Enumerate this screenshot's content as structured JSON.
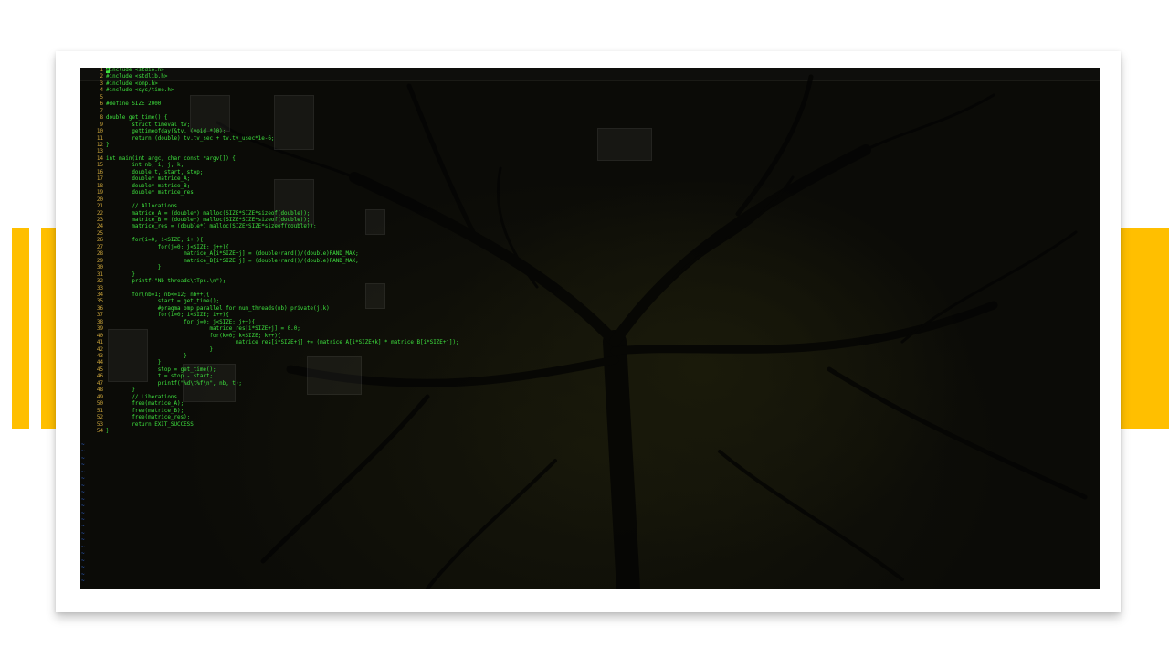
{
  "colors": {
    "accent": "#ffbf00",
    "code_green": "#3ee03e",
    "line_number": "#c8a23a",
    "tilde_blue": "#2f66d8",
    "screen_bg": "#0b0b07"
  },
  "editor": {
    "cursor_char": "#",
    "tilde_count": 21,
    "tilde_char": "~",
    "lines": [
      {
        "n": "1",
        "t": "include <stdio.h>"
      },
      {
        "n": "2",
        "t": "#include <stdlib.h>"
      },
      {
        "n": "3",
        "t": "#include <omp.h>"
      },
      {
        "n": "4",
        "t": "#include <sys/time.h>"
      },
      {
        "n": "5",
        "t": ""
      },
      {
        "n": "6",
        "t": "#define SIZE 2000"
      },
      {
        "n": "7",
        "t": ""
      },
      {
        "n": "8",
        "t": "double get_time() {"
      },
      {
        "n": "9",
        "t": "        struct timeval tv;"
      },
      {
        "n": "10",
        "t": "        gettimeofday(&tv, (void *)0);"
      },
      {
        "n": "11",
        "t": "        return (double) tv.tv_sec + tv.tv_usec*1e-6;"
      },
      {
        "n": "12",
        "t": "}"
      },
      {
        "n": "13",
        "t": ""
      },
      {
        "n": "14",
        "t": "int main(int argc, char const *argv[]) {"
      },
      {
        "n": "15",
        "t": "        int nb, i, j, k;"
      },
      {
        "n": "16",
        "t": "        double t, start, stop;"
      },
      {
        "n": "17",
        "t": "        double* matrice_A;"
      },
      {
        "n": "18",
        "t": "        double* matrice_B;"
      },
      {
        "n": "19",
        "t": "        double* matrice_res;"
      },
      {
        "n": "20",
        "t": ""
      },
      {
        "n": "21",
        "t": "        // Allocations"
      },
      {
        "n": "22",
        "t": "        matrice_A = (double*) malloc(SIZE*SIZE*sizeof(double));"
      },
      {
        "n": "23",
        "t": "        matrice_B = (double*) malloc(SIZE*SIZE*sizeof(double));"
      },
      {
        "n": "24",
        "t": "        matrice_res = (double*) malloc(SIZE*SIZE*sizeof(double));"
      },
      {
        "n": "25",
        "t": ""
      },
      {
        "n": "26",
        "t": "        for(i=0; i<SIZE; i++){"
      },
      {
        "n": "27",
        "t": "                for(j=0; j<SIZE; j++){"
      },
      {
        "n": "28",
        "t": "                        matrice_A[i*SIZE+j] = (double)rand()/(double)RAND_MAX;"
      },
      {
        "n": "29",
        "t": "                        matrice_B[i*SIZE+j] = (double)rand()/(double)RAND_MAX;"
      },
      {
        "n": "30",
        "t": "                }"
      },
      {
        "n": "31",
        "t": "        }"
      },
      {
        "n": "32",
        "t": "        printf(\"Nb-threads\\tTps.\\n\");"
      },
      {
        "n": "33",
        "t": ""
      },
      {
        "n": "34",
        "t": "        for(nb=1; nb<=12; nb++){"
      },
      {
        "n": "35",
        "t": "                start = get_time();"
      },
      {
        "n": "36",
        "t": "                #pragma omp parallel for num_threads(nb) private(j,k)"
      },
      {
        "n": "37",
        "t": "                for(i=0; i<SIZE; i++){"
      },
      {
        "n": "38",
        "t": "                        for(j=0; j<SIZE; j++){"
      },
      {
        "n": "39",
        "t": "                                matrice_res[i*SIZE+j] = 0.0;"
      },
      {
        "n": "40",
        "t": "                                for(k=0; k<SIZE; k++){"
      },
      {
        "n": "41",
        "t": "                                        matrice_res[i*SIZE+j] += (matrice_A[i*SIZE+k] * matrice_B[i*SIZE+j]);"
      },
      {
        "n": "42",
        "t": "                                }"
      },
      {
        "n": "43",
        "t": "                        }"
      },
      {
        "n": "44",
        "t": "                }"
      },
      {
        "n": "45",
        "t": "                stop = get_time();"
      },
      {
        "n": "46",
        "t": "                t = stop - start;"
      },
      {
        "n": "47",
        "t": "                printf(\"%d\\t%f\\n\", nb, t);"
      },
      {
        "n": "48",
        "t": "        }"
      },
      {
        "n": "49",
        "t": "        // Liberations"
      },
      {
        "n": "50",
        "t": "        free(matrice_A);"
      },
      {
        "n": "51",
        "t": "        free(matrice_B);"
      },
      {
        "n": "52",
        "t": "        free(matrice_res);"
      },
      {
        "n": "53",
        "t": "        return EXIT_SUCCESS;"
      },
      {
        "n": "54",
        "t": "}"
      }
    ]
  }
}
